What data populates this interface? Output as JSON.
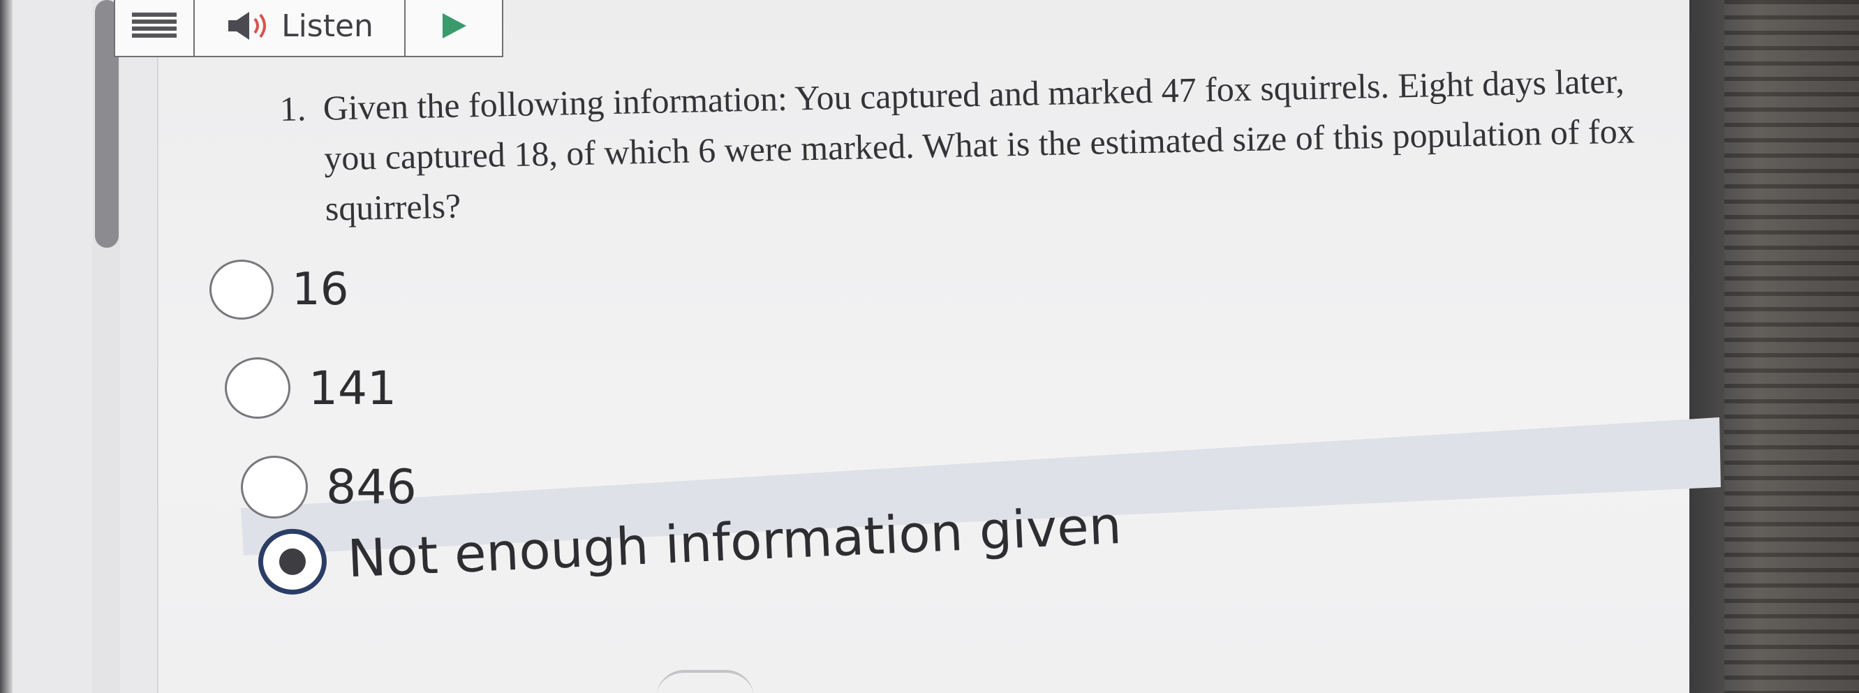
{
  "toolbar": {
    "menu_icon": "hamburger-menu-icon",
    "speaker_icon": "speaker-icon",
    "listen_label": "Listen",
    "play_icon": "play-icon",
    "colors": {
      "speaker_waves": "#d9534f",
      "play": "#3a9a6b"
    }
  },
  "question": {
    "number": "1.",
    "text": "Given the following information: You captured and marked 47 fox squirrels. Eight days later, you captured 18, of which 6 were marked. What is the estimated size of this population of fox squirrels?"
  },
  "options": [
    {
      "label": "16",
      "selected": false
    },
    {
      "label": "141",
      "selected": false
    },
    {
      "label": "846",
      "selected": false
    },
    {
      "label": "Not enough information given",
      "selected": true
    }
  ],
  "colors": {
    "selected_border": "#2a3d66",
    "selected_band": "#dfe1e8"
  }
}
